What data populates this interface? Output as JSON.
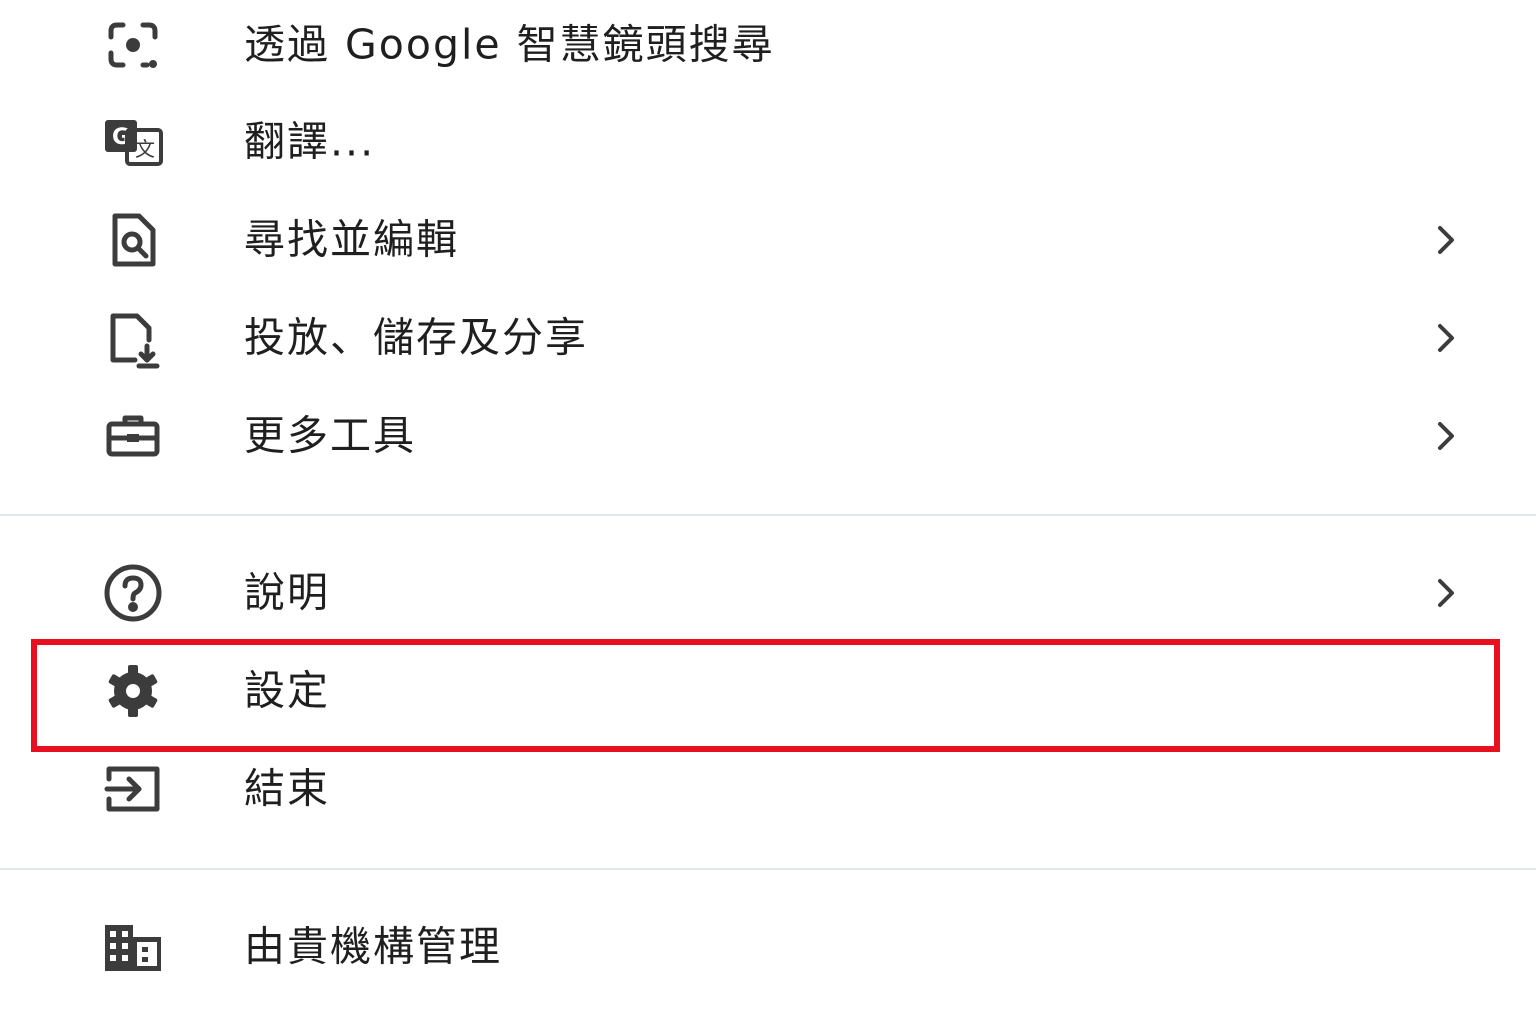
{
  "menu": {
    "items": [
      {
        "id": "lens",
        "label": "透過 Google 智慧鏡頭搜尋",
        "icon": "google-lens-icon",
        "has_submenu": false
      },
      {
        "id": "translate",
        "label": "翻譯...",
        "icon": "translate-icon",
        "has_submenu": false
      },
      {
        "id": "find_edit",
        "label": "尋找並編輯",
        "icon": "find-in-page-icon",
        "has_submenu": true
      },
      {
        "id": "cast_save_share",
        "label": "投放、儲存及分享",
        "icon": "save-download-icon",
        "has_submenu": true
      },
      {
        "id": "more_tools",
        "label": "更多工具",
        "icon": "toolbox-icon",
        "has_submenu": true
      },
      {
        "id": "help",
        "label": "說明",
        "icon": "help-icon",
        "has_submenu": true
      },
      {
        "id": "settings",
        "label": "設定",
        "icon": "gear-icon",
        "has_submenu": false,
        "highlighted": true
      },
      {
        "id": "exit",
        "label": "結束",
        "icon": "exit-icon",
        "has_submenu": false
      },
      {
        "id": "managed",
        "label": "由貴機構管理",
        "icon": "building-icon",
        "has_submenu": false
      }
    ]
  },
  "colors": {
    "highlight_border": "#e8101e",
    "divider": "#dfe6ee",
    "text": "#1f1f1f",
    "icon": "#3c3c3c"
  }
}
